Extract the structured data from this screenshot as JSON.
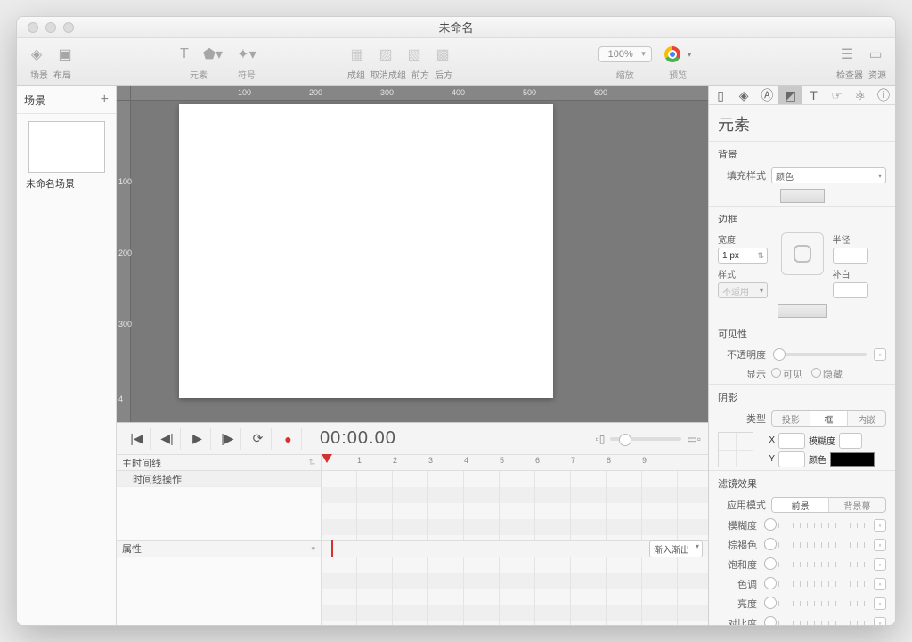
{
  "window": {
    "title": "未命名"
  },
  "toolbar": {
    "groups": {
      "scene_layout": {
        "labels": [
          "场景",
          "布局"
        ]
      },
      "element": {
        "label": "元素"
      },
      "symbol": {
        "label": "符号"
      },
      "group_ops": {
        "labels": [
          "成组",
          "取消成组",
          "前方",
          "后方"
        ]
      },
      "zoom": {
        "value": "100%",
        "label": "缩放"
      },
      "preview": {
        "label": "预览"
      },
      "inspectors": {
        "labels": [
          "检查器",
          "资源"
        ]
      }
    }
  },
  "scenes": {
    "heading": "场景",
    "items": [
      {
        "name": "未命名场景"
      }
    ]
  },
  "rulers": {
    "h": [
      "100",
      "200",
      "300",
      "400",
      "500",
      "600"
    ],
    "v": [
      "100",
      "200",
      "300"
    ],
    "hlabel4": "4"
  },
  "timeline": {
    "timecode": "00:00.00",
    "main_label": "主时间线",
    "actions_label": "时间线操作",
    "properties_label": "属性",
    "easing_label": "渐入渐出",
    "ruler_nums": [
      "1",
      "2",
      "3",
      "4",
      "5",
      "6",
      "7",
      "8",
      "9"
    ]
  },
  "inspector": {
    "title": "元素",
    "sections": {
      "background": {
        "heading": "背景",
        "fill_label": "填充样式",
        "fill_value": "颜色"
      },
      "border": {
        "heading": "边框",
        "width_label": "宽度",
        "width_value": "1 px",
        "style_label": "样式",
        "style_value": "不适用",
        "radius_label": "半径",
        "padding_label": "补白"
      },
      "visibility": {
        "heading": "可见性",
        "opacity_label": "不透明度",
        "display_label": "显示",
        "visible": "可见",
        "hidden": "隐藏"
      },
      "shadow": {
        "heading": "阴影",
        "type_label": "类型",
        "drop": "投影",
        "none": "框",
        "inset": "内嵌",
        "x_label": "X",
        "y_label": "Y",
        "blur_label": "模糊度",
        "color_label": "颜色"
      },
      "filter": {
        "heading": "滤镜效果",
        "apply_label": "应用模式",
        "fg": "前景",
        "bg": "背景幕",
        "blur": "模糊度",
        "sepia": "棕褐色",
        "saturate": "饱和度",
        "hue": "色调",
        "brightness": "亮度",
        "contrast": "对比度"
      }
    }
  }
}
